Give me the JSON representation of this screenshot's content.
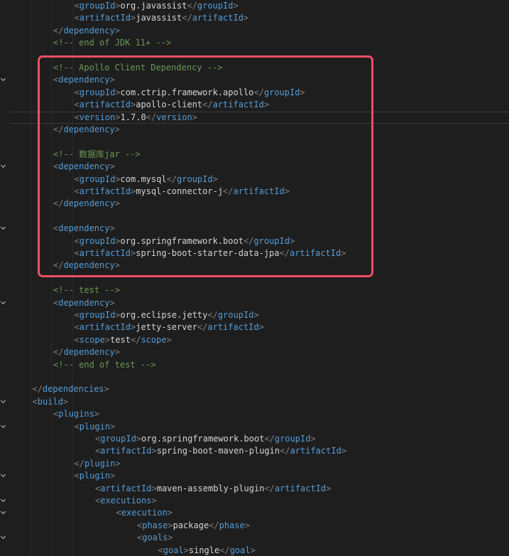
{
  "editor": {
    "language": "xml",
    "lines": [
      {
        "indent": 3,
        "kind": "element",
        "tag": "groupId",
        "text": "org.javassist"
      },
      {
        "indent": 3,
        "kind": "element",
        "tag": "artifactId",
        "text": "javassist"
      },
      {
        "indent": 2,
        "kind": "close",
        "tag": "dependency"
      },
      {
        "indent": 2,
        "kind": "comment",
        "text": "<!-- end of JDK 11+ -->"
      },
      {
        "indent": 0,
        "kind": "blank"
      },
      {
        "indent": 2,
        "kind": "comment",
        "text": "<!-- Apollo Client Dependency -->"
      },
      {
        "indent": 2,
        "kind": "open",
        "tag": "dependency"
      },
      {
        "indent": 3,
        "kind": "element",
        "tag": "groupId",
        "text": "com.ctrip.framework.apollo"
      },
      {
        "indent": 3,
        "kind": "element",
        "tag": "artifactId",
        "text": "apollo-client"
      },
      {
        "indent": 3,
        "kind": "element",
        "tag": "version",
        "text": "1.7.0"
      },
      {
        "indent": 2,
        "kind": "close",
        "tag": "dependency"
      },
      {
        "indent": 0,
        "kind": "blank"
      },
      {
        "indent": 2,
        "kind": "comment",
        "text": "<!-- 数据库jar -->"
      },
      {
        "indent": 2,
        "kind": "open",
        "tag": "dependency"
      },
      {
        "indent": 3,
        "kind": "element",
        "tag": "groupId",
        "text": "com.mysql"
      },
      {
        "indent": 3,
        "kind": "element",
        "tag": "artifactId",
        "text": "mysql-connector-j"
      },
      {
        "indent": 2,
        "kind": "close",
        "tag": "dependency"
      },
      {
        "indent": 0,
        "kind": "blank"
      },
      {
        "indent": 2,
        "kind": "open",
        "tag": "dependency"
      },
      {
        "indent": 3,
        "kind": "element",
        "tag": "groupId",
        "text": "org.springframework.boot"
      },
      {
        "indent": 3,
        "kind": "element",
        "tag": "artifactId",
        "text": "spring-boot-starter-data-jpa"
      },
      {
        "indent": 2,
        "kind": "close",
        "tag": "dependency"
      },
      {
        "indent": 0,
        "kind": "blank"
      },
      {
        "indent": 2,
        "kind": "comment",
        "text": "<!-- test -->"
      },
      {
        "indent": 2,
        "kind": "open",
        "tag": "dependency"
      },
      {
        "indent": 3,
        "kind": "element",
        "tag": "groupId",
        "text": "org.eclipse.jetty"
      },
      {
        "indent": 3,
        "kind": "element",
        "tag": "artifactId",
        "text": "jetty-server"
      },
      {
        "indent": 3,
        "kind": "element",
        "tag": "scope",
        "text": "test"
      },
      {
        "indent": 2,
        "kind": "close",
        "tag": "dependency"
      },
      {
        "indent": 2,
        "kind": "comment",
        "text": "<!-- end of test -->"
      },
      {
        "indent": 0,
        "kind": "blank"
      },
      {
        "indent": 1,
        "kind": "close",
        "tag": "dependencies"
      },
      {
        "indent": 1,
        "kind": "open",
        "tag": "build"
      },
      {
        "indent": 2,
        "kind": "open",
        "tag": "plugins"
      },
      {
        "indent": 3,
        "kind": "open",
        "tag": "plugin"
      },
      {
        "indent": 4,
        "kind": "element",
        "tag": "groupId",
        "text": "org.springframework.boot"
      },
      {
        "indent": 4,
        "kind": "element",
        "tag": "artifactId",
        "text": "spring-boot-maven-plugin"
      },
      {
        "indent": 3,
        "kind": "close",
        "tag": "plugin"
      },
      {
        "indent": 3,
        "kind": "open",
        "tag": "plugin"
      },
      {
        "indent": 4,
        "kind": "element",
        "tag": "artifactId",
        "text": "maven-assembly-plugin"
      },
      {
        "indent": 4,
        "kind": "open",
        "tag": "executions"
      },
      {
        "indent": 5,
        "kind": "open",
        "tag": "execution"
      },
      {
        "indent": 6,
        "kind": "element",
        "tag": "phase",
        "text": "package"
      },
      {
        "indent": 6,
        "kind": "open",
        "tag": "goals"
      },
      {
        "indent": 7,
        "kind": "element",
        "tag": "goal",
        "text": "single"
      }
    ],
    "current_line_index": 9,
    "fold_marker_lines": [
      6,
      13,
      18,
      24,
      32,
      34,
      38,
      40,
      41,
      43
    ],
    "colors": {
      "background": "#1e1e1e",
      "tag": "#569cd6",
      "bracket": "#808080",
      "text": "#d4d4d4",
      "comment": "#6a9955",
      "highlight_box": "#ef4f62"
    }
  }
}
